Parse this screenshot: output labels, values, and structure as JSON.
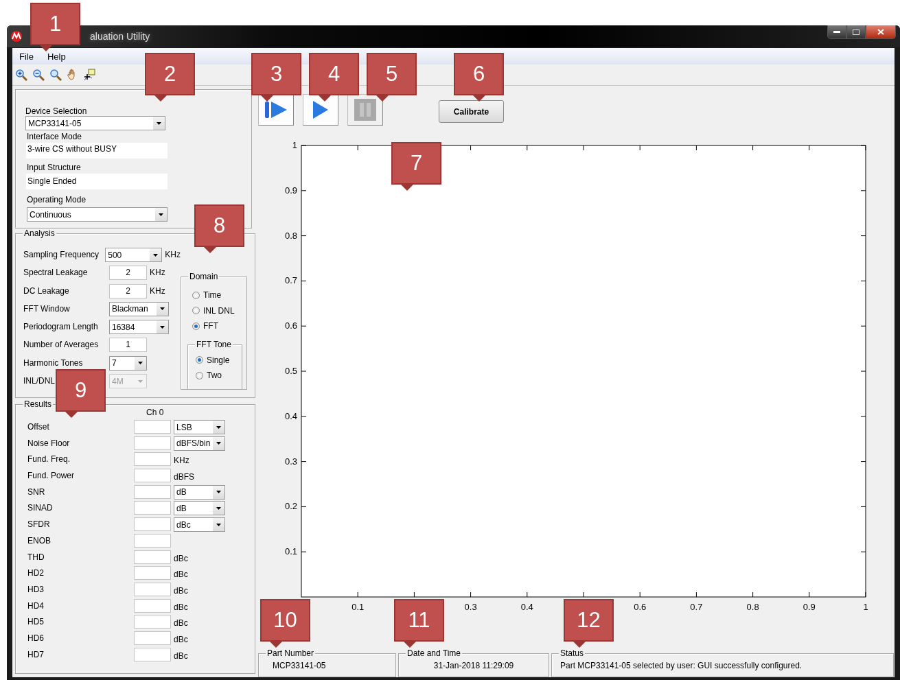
{
  "window": {
    "title": "aluation Utility"
  },
  "menu": [
    "File",
    "Help"
  ],
  "device_panel": {
    "fields": [
      {
        "kind": "combo",
        "label": "Device Selection",
        "value": "MCP33141-05"
      },
      {
        "kind": "text",
        "label": "Interface Mode",
        "value": "3-wire CS without BUSY"
      },
      {
        "kind": "text",
        "label": "Input Structure",
        "value": "Single Ended"
      },
      {
        "kind": "combo",
        "label": "Operating Mode",
        "value": "Continuous"
      }
    ]
  },
  "analysis": {
    "title": "Analysis",
    "rows": [
      {
        "kind": "combo",
        "label": "Sampling Frequency",
        "value": "500",
        "unit": "KHz",
        "disabled": false
      },
      {
        "kind": "number",
        "label": "Spectral Leakage",
        "value": "2",
        "unit": "KHz",
        "disabled": false
      },
      {
        "kind": "number",
        "label": "DC Leakage",
        "value": "2",
        "unit": "KHz",
        "disabled": false
      },
      {
        "kind": "combo",
        "label": "FFT Window",
        "value": "Blackman",
        "disabled": false
      },
      {
        "kind": "combo",
        "label": "Periodogram Length",
        "value": "16384",
        "disabled": false
      },
      {
        "kind": "number",
        "label": "Number of Averages",
        "value": "1",
        "disabled": false
      },
      {
        "kind": "small_combo",
        "label": "Harmonic Tones",
        "value": "7",
        "disabled": false
      },
      {
        "kind": "small_combo",
        "label": "INL/DNL",
        "value": "4M",
        "disabled": true
      }
    ],
    "domain": {
      "title": "Domain",
      "options": [
        {
          "label": "Time",
          "selected": false
        },
        {
          "label": "INL DNL",
          "selected": false
        },
        {
          "label": "FFT",
          "selected": true
        }
      ]
    },
    "fft_tone": {
      "title": "FFT Tone",
      "options": [
        {
          "label": "Single",
          "selected": true
        },
        {
          "label": "Two",
          "selected": false
        }
      ]
    }
  },
  "results": {
    "title": "Results",
    "column": "Ch 0",
    "rows": [
      {
        "label": "Offset",
        "kind": "combo",
        "unit": "LSB"
      },
      {
        "label": "Noise Floor",
        "kind": "combo",
        "unit": "dBFS/bin"
      },
      {
        "label": "Fund. Freq.",
        "kind": "text",
        "unit": "KHz"
      },
      {
        "label": "Fund. Power",
        "kind": "text",
        "unit": "dBFS"
      },
      {
        "label": "SNR",
        "kind": "combo",
        "unit": "dB"
      },
      {
        "label": "SINAD",
        "kind": "combo",
        "unit": "dB"
      },
      {
        "label": "SFDR",
        "kind": "combo",
        "unit": "dBc"
      },
      {
        "label": "ENOB",
        "kind": "none"
      },
      {
        "label": "THD",
        "kind": "text",
        "unit": "dBc"
      },
      {
        "label": "HD2",
        "kind": "text",
        "unit": "dBc"
      },
      {
        "label": "HD3",
        "kind": "text",
        "unit": "dBc"
      },
      {
        "label": "HD4",
        "kind": "text",
        "unit": "dBc"
      },
      {
        "label": "HD5",
        "kind": "text",
        "unit": "dBc"
      },
      {
        "label": "HD6",
        "kind": "text",
        "unit": "dBc"
      },
      {
        "label": "HD7",
        "kind": "text",
        "unit": "dBc"
      }
    ]
  },
  "transport_buttons": [
    {
      "kind": "step",
      "disabled": false
    },
    {
      "kind": "run",
      "disabled": false
    },
    {
      "kind": "pause",
      "disabled": true
    }
  ],
  "calibrate_button": "Calibrate",
  "chart": {
    "chart_data": {
      "type": "line",
      "xlim": [
        0,
        1
      ],
      "ylim": [
        0,
        1
      ],
      "xticks": [
        0.1,
        0.3,
        0.4,
        0.6,
        0.7,
        0.8,
        0.9,
        1
      ],
      "yticks": [
        0.1,
        0.2,
        0.3,
        0.4,
        0.5,
        0.6,
        0.7,
        0.8,
        0.9,
        1
      ]
    }
  },
  "status": [
    {
      "title": "Part Number",
      "value": "MCP33141-05"
    },
    {
      "title": "Date and Time",
      "value": "31-Jan-2018 11:29:09"
    },
    {
      "title": "Status",
      "value": "Part MCP33141-05 selected by user: GUI successfully configured."
    }
  ],
  "callouts": [
    "1",
    "2",
    "3",
    "4",
    "5",
    "6",
    "7",
    "8",
    "9",
    "10",
    "11",
    "12"
  ]
}
